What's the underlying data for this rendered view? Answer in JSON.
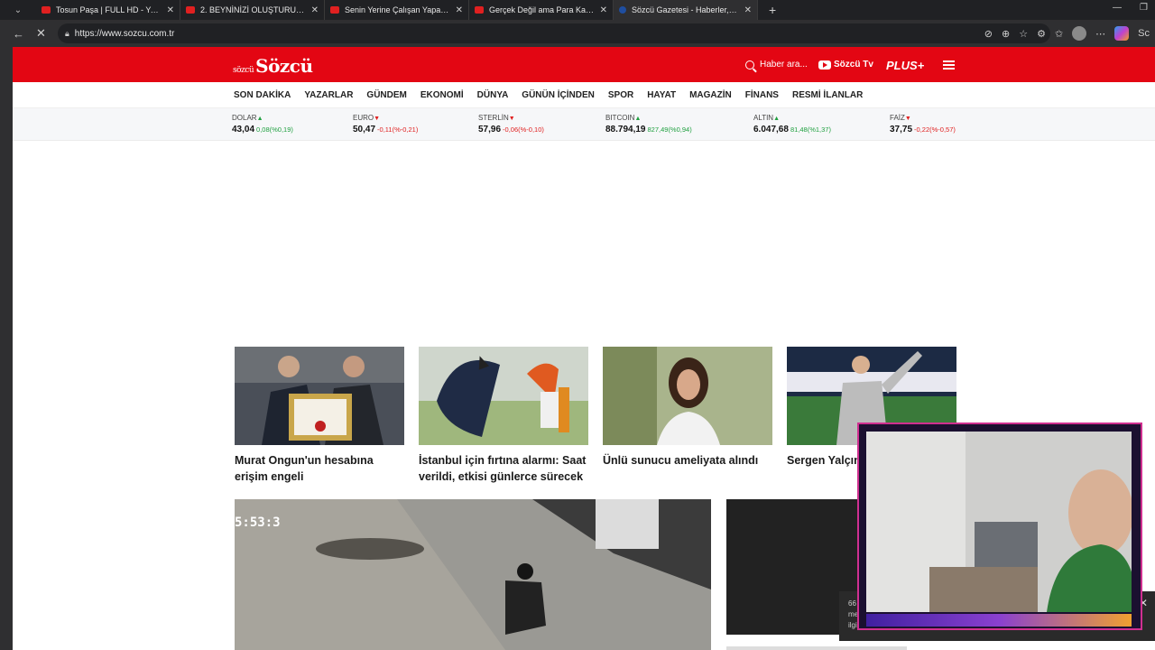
{
  "browser": {
    "tabs": [
      {
        "label": "Tosun Paşa | FULL HD - YouTube",
        "active": false,
        "favicon": "youtube-icon"
      },
      {
        "label": "2. BEYNİNİZİ OLUŞTURUN: Notebo",
        "active": false,
        "favicon": "youtube-icon"
      },
      {
        "label": "Senin Yerine Çalışan Yapay Zeka A",
        "active": false,
        "favicon": "youtube-icon"
      },
      {
        "label": "Gerçek Değil ama Para Kazanıyor",
        "active": false,
        "favicon": "youtube-icon"
      },
      {
        "label": "Sözcü Gazetesi - Haberler, son da",
        "active": true,
        "favicon": "sozcu-icon"
      }
    ],
    "url": "https://www.sozcu.com.tr",
    "profile_text": "Sc"
  },
  "header": {
    "logo_prefix": "sözcü",
    "logo": "Sözcü",
    "search_label": "Haber ara...",
    "tv_label": "Sözcü Tv",
    "plus_label": "PLUS+",
    "brand_color": "#e30613"
  },
  "nav": {
    "items": [
      "SON DAKİKA",
      "YAZARLAR",
      "GÜNDEM",
      "EKONOMİ",
      "DÜNYA",
      "GÜNÜN İÇİNDEN",
      "SPOR",
      "HAYAT",
      "MAGAZİN",
      "FİNANS",
      "RESMİ İLANLAR"
    ]
  },
  "ticker": [
    {
      "name": "DOLAR",
      "dir": "up",
      "value": "43,04",
      "change": "0,08(%0,19)"
    },
    {
      "name": "EURO",
      "dir": "down",
      "value": "50,47",
      "change": "-0,11(%-0,21)"
    },
    {
      "name": "STERLİN",
      "dir": "down",
      "value": "57,96",
      "change": "-0,06(%-0,10)"
    },
    {
      "name": "BITCOIN",
      "dir": "up",
      "value": "88.794,19",
      "change": "827,49(%0,94)"
    },
    {
      "name": "ALTIN",
      "dir": "up",
      "value": "6.047,68",
      "change": "81,48(%1,37)"
    },
    {
      "name": "FAİZ",
      "dir": "down",
      "value": "37,75",
      "change": "-0,22(%-0,57)"
    }
  ],
  "news": [
    {
      "title": "Murat Ongun'un hesabına erişim engeli"
    },
    {
      "title": "İstanbul için fırtına alarmı: Saat verildi, etkisi günlerce sürecek"
    },
    {
      "title": "Ünlü sunucu ameliyata alındı"
    },
    {
      "title": "Sergen Yalçın a devine gidiyor"
    }
  ],
  "featured": {
    "timestamp": "5:53:3"
  },
  "overlay": {
    "caption_line1": "66",
    "caption_line2": "me",
    "caption_line3": "ilgili b"
  }
}
